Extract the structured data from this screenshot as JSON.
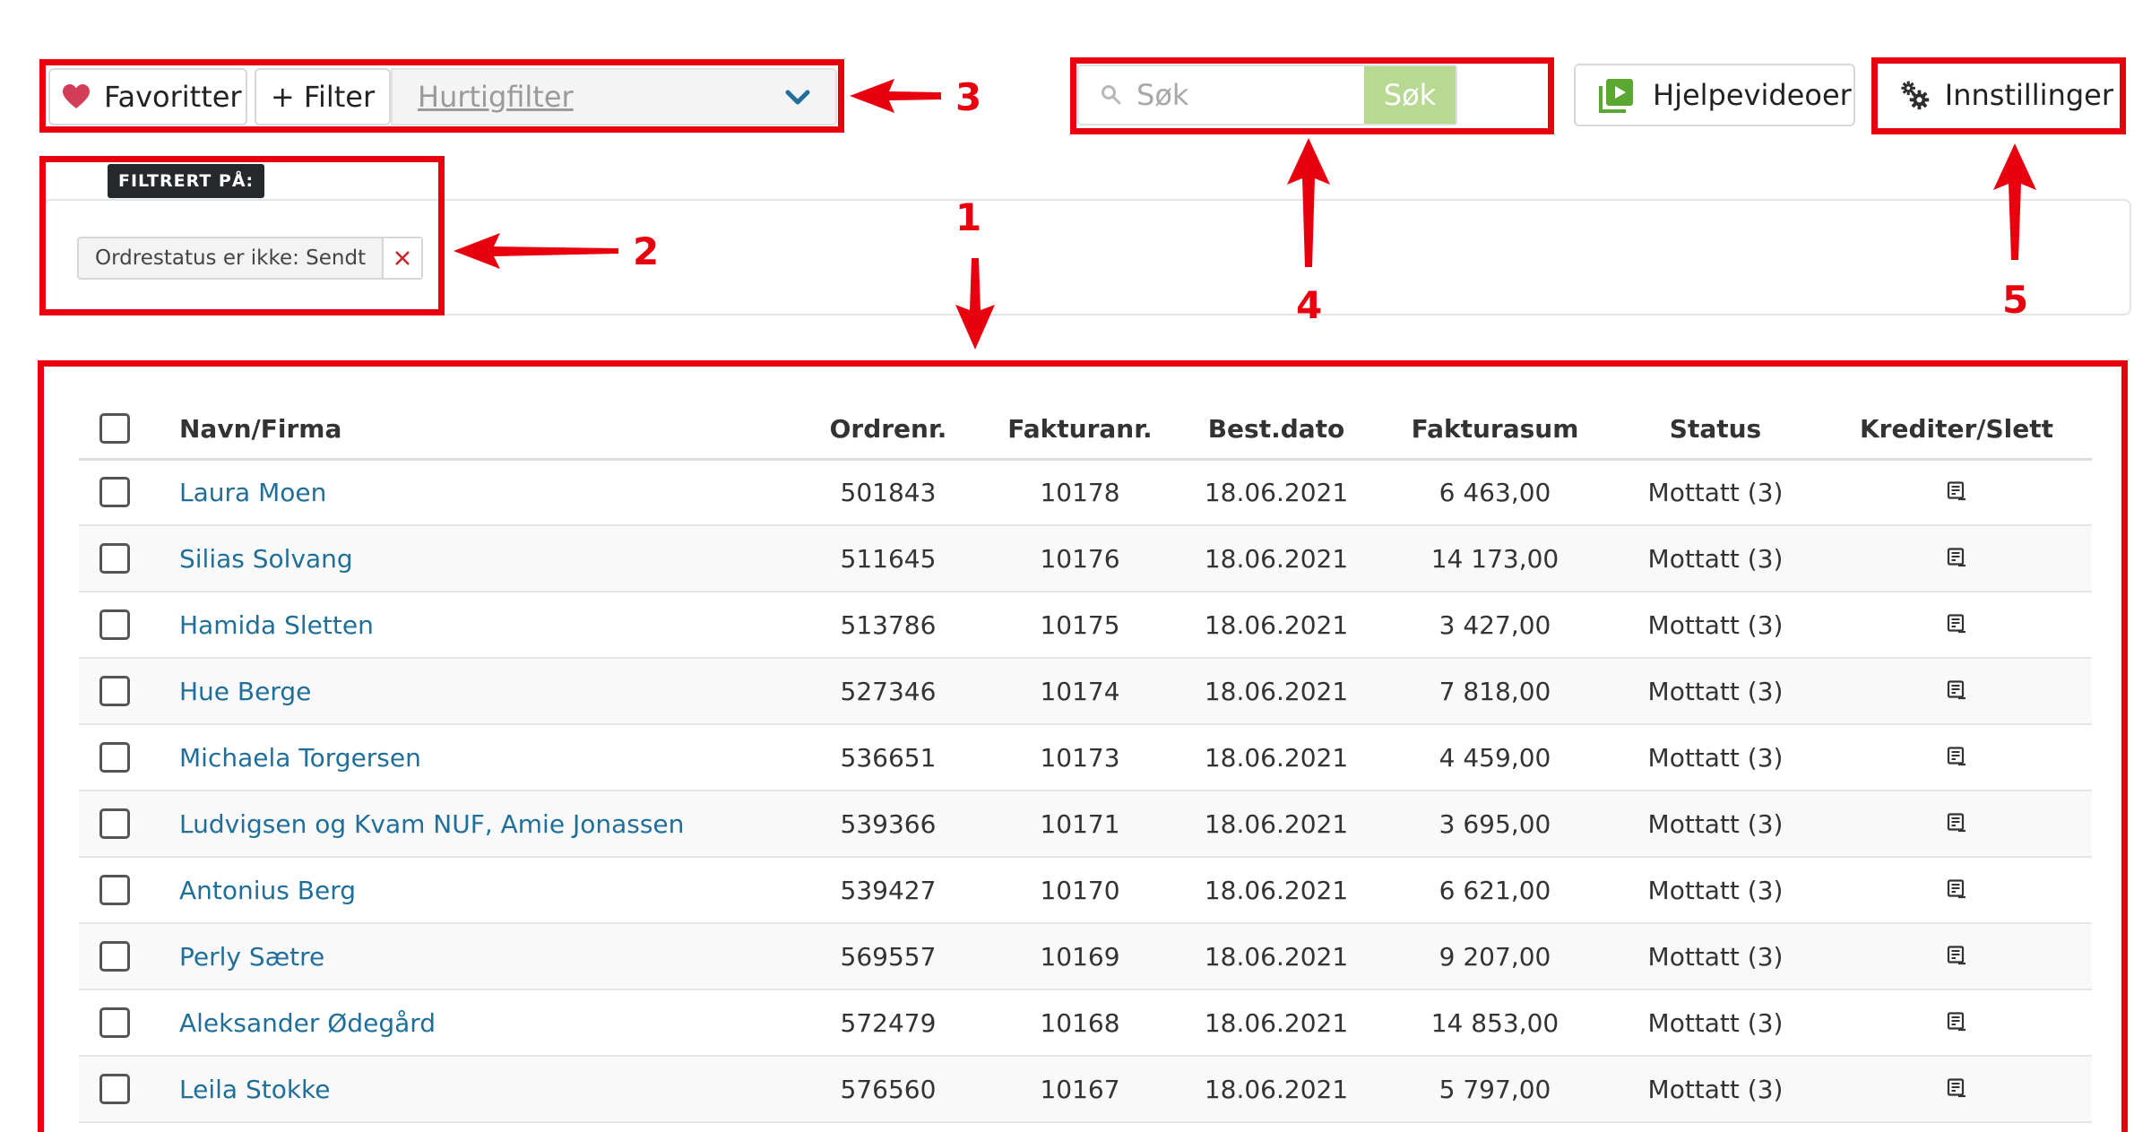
{
  "toolbar": {
    "favorites_label": "Favoritter",
    "filter_label": "+ Filter",
    "quick_filter_placeholder": "Hurtigfilter",
    "search_placeholder": "Søk",
    "search_button_label": "Søk",
    "help_videos_label": "Hjelpevideoer",
    "settings_label": "Innstillinger"
  },
  "filters": {
    "heading": "FILTRERT PÅ:",
    "active_filter": "Ordrestatus er ikke: Sendt"
  },
  "table": {
    "columns": [
      "Navn/Firma",
      "Ordrenr.",
      "Fakturanr.",
      "Best.dato",
      "Fakturasum",
      "Status",
      "Krediter/Slett"
    ],
    "rows": [
      {
        "name": "Laura Moen",
        "order": "501843",
        "invoice": "10178",
        "date": "18.06.2021",
        "sum": "6 463,00",
        "status": "Mottatt (3)"
      },
      {
        "name": "Silias Solvang",
        "order": "511645",
        "invoice": "10176",
        "date": "18.06.2021",
        "sum": "14 173,00",
        "status": "Mottatt (3)"
      },
      {
        "name": "Hamida Sletten",
        "order": "513786",
        "invoice": "10175",
        "date": "18.06.2021",
        "sum": "3 427,00",
        "status": "Mottatt (3)"
      },
      {
        "name": "Hue Berge",
        "order": "527346",
        "invoice": "10174",
        "date": "18.06.2021",
        "sum": "7 818,00",
        "status": "Mottatt (3)"
      },
      {
        "name": "Michaela Torgersen",
        "order": "536651",
        "invoice": "10173",
        "date": "18.06.2021",
        "sum": "4 459,00",
        "status": "Mottatt (3)"
      },
      {
        "name": "Ludvigsen og Kvam NUF, Amie Jonassen",
        "order": "539366",
        "invoice": "10171",
        "date": "18.06.2021",
        "sum": "3 695,00",
        "status": "Mottatt (3)"
      },
      {
        "name": "Antonius Berg",
        "order": "539427",
        "invoice": "10170",
        "date": "18.06.2021",
        "sum": "6 621,00",
        "status": "Mottatt (3)"
      },
      {
        "name": "Perly Sætre",
        "order": "569557",
        "invoice": "10169",
        "date": "18.06.2021",
        "sum": "9 207,00",
        "status": "Mottatt (3)"
      },
      {
        "name": "Aleksander Ødegård",
        "order": "572479",
        "invoice": "10168",
        "date": "18.06.2021",
        "sum": "14 853,00",
        "status": "Mottatt (3)"
      },
      {
        "name": "Leila Stokke",
        "order": "576560",
        "invoice": "10167",
        "date": "18.06.2021",
        "sum": "5 797,00",
        "status": "Mottatt (3)"
      }
    ]
  },
  "annotations": {
    "labels": [
      "1",
      "2",
      "3",
      "4",
      "5"
    ],
    "color": "#e8000f"
  },
  "colors": {
    "link": "#1f6f9a",
    "search_button": "#b7d991",
    "heart": "#d33d57",
    "help_icon": "#5aa832"
  }
}
